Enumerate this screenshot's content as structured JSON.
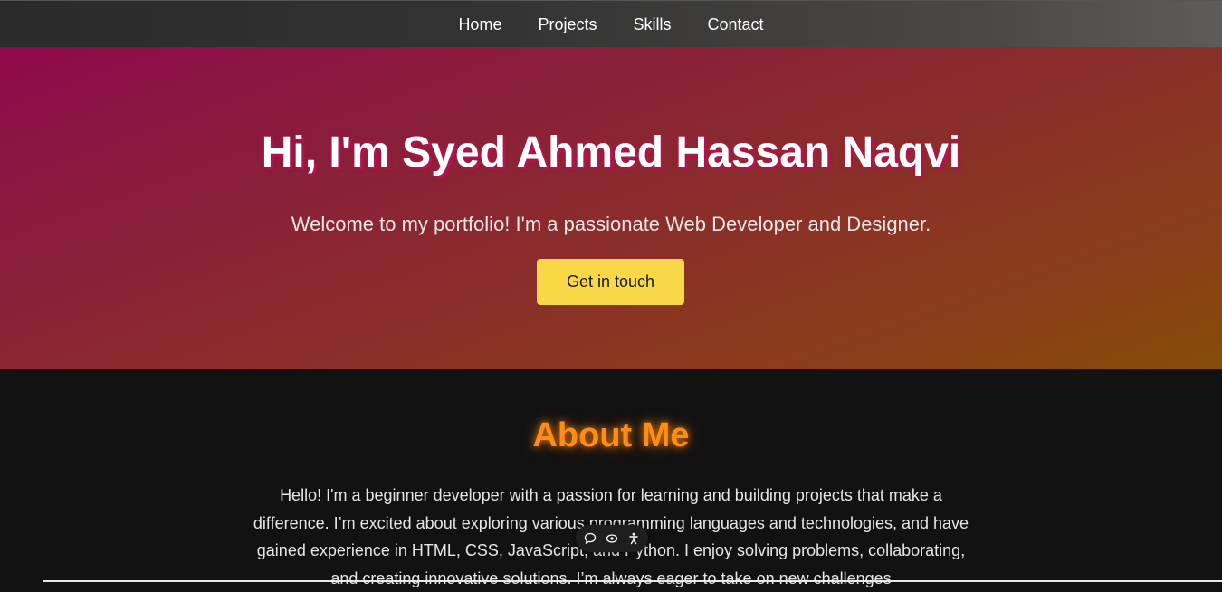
{
  "nav": {
    "items": [
      {
        "label": "Home"
      },
      {
        "label": "Projects"
      },
      {
        "label": "Skills"
      },
      {
        "label": "Contact"
      }
    ]
  },
  "hero": {
    "title": "Hi, I'm Syed Ahmed Hassan Naqvi",
    "subtitle": "Welcome to my portfolio! I'm a passionate Web Developer and Designer.",
    "cta_label": "Get in touch"
  },
  "about": {
    "title": "About Me",
    "text": "Hello! I'm a beginner developer with a passion for learning and building projects that make a difference. I’m excited about exploring various programming languages and technologies, and have gained experience in HTML, CSS, JavaScript, and Python. I enjoy solving problems, collaborating, and creating innovative solutions. I’m always eager to take on new challenges"
  },
  "toolbar": {
    "icons": [
      "comment-icon",
      "eye-icon",
      "accessibility-icon"
    ]
  },
  "colors": {
    "cta_bg": "#f8d846",
    "about_title": "#ff8c14",
    "hero_gradient_start": "#8f0a4c",
    "hero_gradient_end": "#864c08",
    "page_bg": "#121212"
  }
}
